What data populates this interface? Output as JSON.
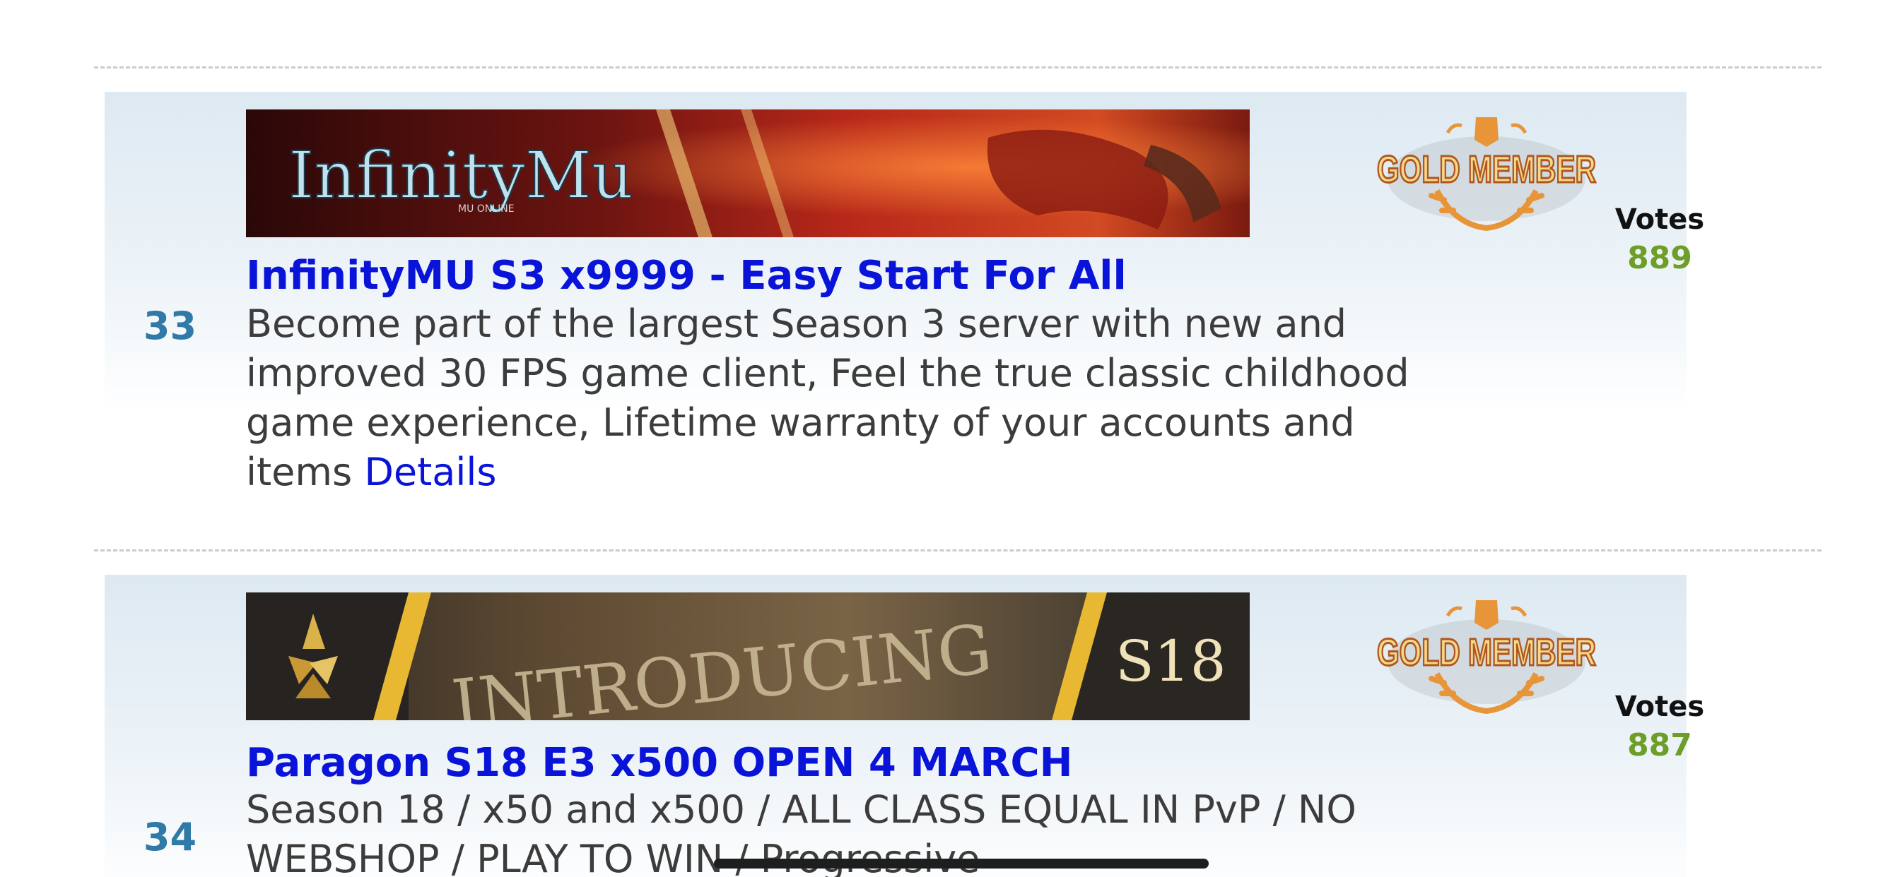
{
  "entries": [
    {
      "rank": "33",
      "banner_text": "InfinityMu",
      "banner_subtext": "MU ONLINE",
      "title": "InfinityMU S3 x9999 - Easy Start For All",
      "description": "Become part of the largest Season 3 server with new and improved 30 FPS game client, Feel the true classic childhood game experience, Lifetime warranty of your accounts and items",
      "details_label": "Details",
      "badge": "GOLD MEMBER",
      "votes_label": "Votes",
      "votes": "889"
    },
    {
      "rank": "34",
      "banner_text": "INTRODUCING",
      "banner_tag": "S18",
      "title": "Paragon S18 E3 x500 OPEN 4 MARCH",
      "description": "Season 18 / x50 and x500 / ALL CLASS EQUAL IN PvP / NO WEBSHOP / PLAY TO WIN / Progressive",
      "badge": "GOLD MEMBER",
      "votes_label": "Votes",
      "votes": "887"
    }
  ],
  "colors": {
    "title_link": "#0a14d9",
    "rank": "#2f7aa6",
    "votes_count": "#6e9e2a",
    "badge_gold": "#e8953a"
  }
}
